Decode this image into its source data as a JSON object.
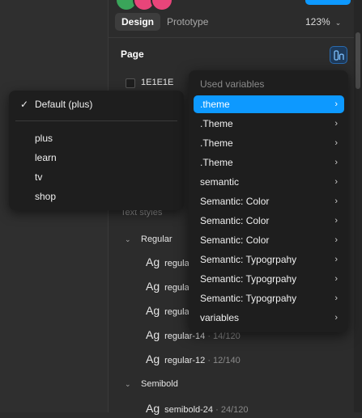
{
  "colors": {
    "accent": "#0d99ff",
    "panel_bg": "#2c2c2c",
    "menu_bg": "#1e1e1e"
  },
  "toolbar": {
    "tabs": [
      {
        "label": "Design",
        "active": true
      },
      {
        "label": "Prototype",
        "active": false
      }
    ],
    "zoom": "123%",
    "zoom_icon": "chevron-down-icon"
  },
  "page_section": {
    "title": "Page",
    "background_hex": "1E1E1E",
    "variable_icon": "library-variable-icon"
  },
  "mode_menu": {
    "selected": "Default (plus)",
    "options": [
      "plus",
      "learn",
      "tv",
      "shop"
    ]
  },
  "variables_menu": {
    "header": "Used variables",
    "items": [
      {
        "label": ".theme",
        "selected": true
      },
      {
        "label": ".Theme",
        "selected": false
      },
      {
        "label": ".Theme",
        "selected": false
      },
      {
        "label": ".Theme",
        "selected": false
      },
      {
        "label": "semantic",
        "selected": false
      },
      {
        "label": "Semantic: Color",
        "selected": false
      },
      {
        "label": "Semantic: Color",
        "selected": false
      },
      {
        "label": "Semantic: Color",
        "selected": false
      },
      {
        "label": "Semantic: Typogrpahy",
        "selected": false
      },
      {
        "label": "Semantic: Typogrpahy",
        "selected": false
      },
      {
        "label": "Semantic: Typogrpahy",
        "selected": false
      },
      {
        "label": "variables",
        "selected": false
      }
    ]
  },
  "text_styles": {
    "title": "Text styles",
    "groups": [
      {
        "name": "Regular",
        "styles": [
          {
            "sample": "Ag",
            "name": "regular",
            "meta": ""
          },
          {
            "sample": "Ag",
            "name": "regular",
            "meta": ""
          },
          {
            "sample": "Ag",
            "name": "regular",
            "meta": ""
          },
          {
            "sample": "Ag",
            "name": "regular-14",
            "meta": " · 14/120"
          },
          {
            "sample": "Ag",
            "name": "regular-12",
            "meta": " · 12/140"
          }
        ]
      },
      {
        "name": "Semibold",
        "styles": [
          {
            "sample": "Ag",
            "name": "semibold-24",
            "meta": " · 24/120"
          }
        ]
      }
    ]
  }
}
